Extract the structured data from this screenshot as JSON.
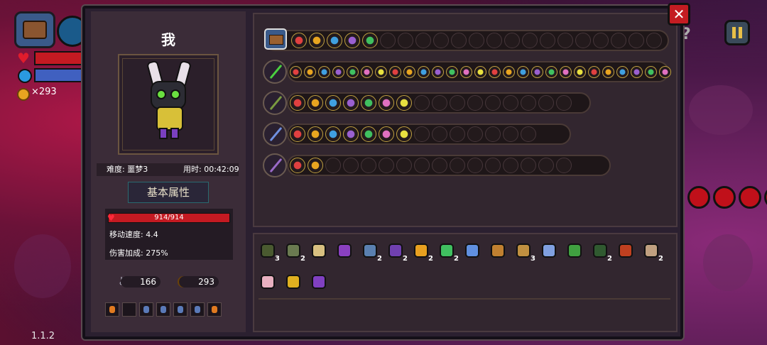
{
  "hud": {
    "gold_count": "×293",
    "version": "1.1.2"
  },
  "panel": {
    "player_name": "我",
    "difficulty": "难度: 噩梦3",
    "time_used": "用时: 00:42:09",
    "attr_tab": "基本属性",
    "hp": "914/914",
    "move_speed": "移动速度: 4.4",
    "damage_bonus": "伤害加成: 275%",
    "keys": "166",
    "coins": "293"
  },
  "potion_slots": [
    {
      "icon": "potion-yellow-icon"
    },
    {
      "icon": "empty-slot"
    },
    {
      "icon": "potion-blue-icon"
    },
    {
      "icon": "potion-blue-icon"
    },
    {
      "icon": "potion-blue-icon"
    },
    {
      "icon": "potion-blue-icon"
    },
    {
      "icon": "potion-orange-icon"
    }
  ],
  "weapon_rows": [
    {
      "weapon_icon": "green-staff-icon"
    },
    {
      "weapon_icon": "vine-staff-icon"
    },
    {
      "weapon_icon": "blue-sword-icon"
    },
    {
      "weapon_icon": "purple-staff-icon"
    }
  ],
  "top_row_icons": [
    "chest-icon",
    "blue-cat-icon",
    "gear-orb-icon",
    "green-swirl-icon",
    "pink-flower-icon",
    "purple-vortex-icon"
  ],
  "items": [
    {
      "icon": "skull-mask-icon",
      "count": "3"
    },
    {
      "icon": "arrow-icon",
      "count": "2"
    },
    {
      "icon": "egg-icon",
      "count": ""
    },
    {
      "icon": "purple-boot-icon",
      "count": ""
    },
    {
      "icon": "crystal-icon",
      "count": "2"
    },
    {
      "icon": "witch-hat-icon",
      "count": "2"
    },
    {
      "icon": "honey-pot-icon",
      "count": "2"
    },
    {
      "icon": "green-fly-icon",
      "count": "2"
    },
    {
      "icon": "water-drop-icon",
      "count": ""
    },
    {
      "icon": "scroll-icon",
      "count": ""
    },
    {
      "icon": "pickaxe-icon",
      "count": "3"
    },
    {
      "icon": "magnifier-icon",
      "count": ""
    },
    {
      "icon": "green-crown-icon",
      "count": ""
    },
    {
      "icon": "green-belt-icon",
      "count": "2"
    },
    {
      "icon": "red-map-icon",
      "count": ""
    },
    {
      "icon": "bone-icon",
      "count": "2"
    },
    {
      "icon": "feather-icon",
      "count": ""
    },
    {
      "icon": "gold-crown-icon",
      "count": ""
    },
    {
      "icon": "rainbow-shield-icon",
      "count": ""
    }
  ],
  "colors": {
    "panel_bg": "#2b2030",
    "hp_red": "#c41a22",
    "accent_gold": "#e8a520"
  }
}
